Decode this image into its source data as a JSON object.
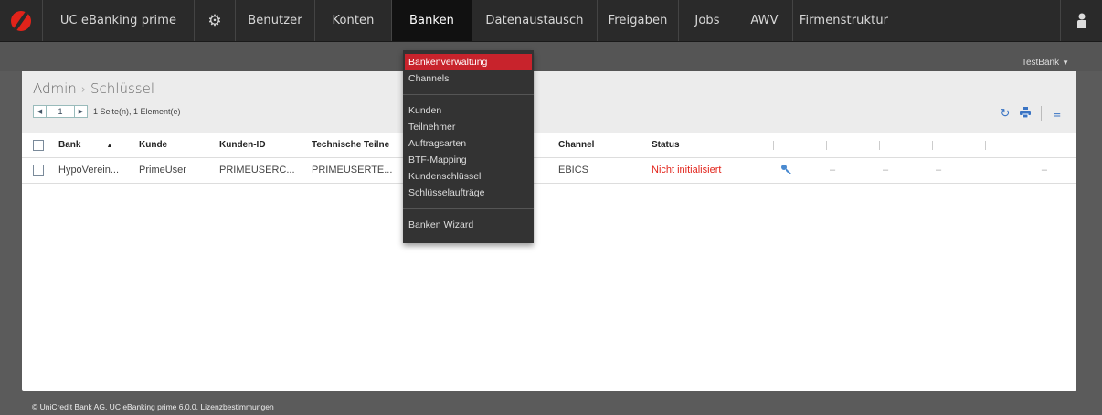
{
  "app": {
    "brand": "UC eBanking prime",
    "bank_selector": "TestBank",
    "accent": "#e2231a"
  },
  "nav": {
    "items": [
      {
        "label": "Benutzer",
        "width": 87
      },
      {
        "label": "Konten",
        "width": 84
      },
      {
        "label": "Banken",
        "width": 88,
        "active": true
      },
      {
        "label": "Datenaustausch",
        "width": 137
      },
      {
        "label": "Freigaben",
        "width": 89
      },
      {
        "label": "Jobs",
        "width": 63
      },
      {
        "label": "AWV",
        "width": 62
      },
      {
        "label": "Firmenstruktur",
        "width": 112
      }
    ]
  },
  "breadcrumb": {
    "root": "Admin",
    "separator": "›",
    "current": "Schlüssel"
  },
  "pager": {
    "page": "1",
    "info": "1 Seite(n), 1 Element(e)"
  },
  "table": {
    "headers": [
      "Bank",
      "Kunde",
      "Kunden-ID",
      "Technische Teilne",
      "Channel",
      "Status"
    ],
    "row": {
      "bank": "HypoVerein...",
      "kunde": "PrimeUser",
      "kunden_id": "PRIMEUSERC...",
      "technische": "PRIMEUSERTE...",
      "channel": "EBICS",
      "status": "Nicht initialisiert",
      "dash": "–"
    }
  },
  "dropdown": {
    "group1": [
      "Bankenverwaltung",
      "Channels"
    ],
    "group2": [
      "Kunden",
      "Teilnehmer",
      "Auftragsarten",
      "BTF-Mapping",
      "Kundenschlüssel",
      "Schlüsselaufträge"
    ],
    "group3": [
      "Banken Wizard"
    ]
  },
  "footer": "© UniCredit Bank AG,  UC eBanking prime 6.0.0,  Lizenzbestimmungen"
}
